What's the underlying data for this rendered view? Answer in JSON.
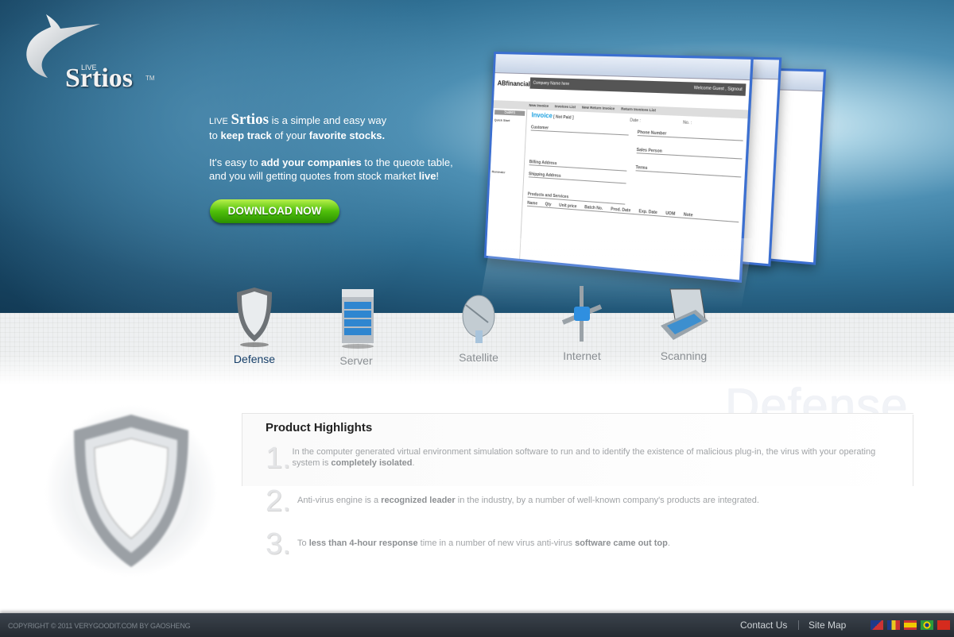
{
  "brand": {
    "name": "Srtios",
    "prefix": "LIVE",
    "tm": "TM"
  },
  "hero": {
    "line1_brand": "Srtios",
    "line1_prefix": "LIVE",
    "line1_rest": " is a simple and easy way",
    "line2_a": "to ",
    "line2_b": "keep track",
    "line2_c": " of your ",
    "line2_d": "favorite stocks.",
    "line3_a": "It's easy to ",
    "line3_b": "add your companies",
    "line3_c": " to the queote table,",
    "line4_a": "and you will getting quotes from stock market ",
    "line4_b": "live",
    "line4_c": "!",
    "download_label": "DOWNLOAD NOW"
  },
  "mockup": {
    "company": "Company Name here",
    "welcome": "Welcome Guest , Signout",
    "logo": "ABfinancial",
    "section": "Sales",
    "tabs": [
      "New Invoice",
      "Invoices List",
      "New Return Invoice",
      "Return Invoices List"
    ],
    "invoice": "Invoice",
    "status": "[ Not Paid ]",
    "date": "Date :",
    "no": "No. :",
    "groups": [
      "Customer",
      "Billing Address",
      "Shipping Address",
      "Phone Number",
      "Sales Person",
      "Terms"
    ],
    "products": "Products and Services",
    "columns": [
      "Name",
      "Qty",
      "Unit price",
      "Batch No.",
      "Prod. Date",
      "Exp. Date",
      "UOM",
      "Note"
    ],
    "quick_start": "Quick Start",
    "reminder": "Reminder"
  },
  "categories": [
    {
      "label": "Defense",
      "icon": "shield-icon",
      "active": true
    },
    {
      "label": "Server",
      "icon": "server-icon",
      "active": false
    },
    {
      "label": "Satellite",
      "icon": "satellite-dish-icon",
      "active": false
    },
    {
      "label": "Internet",
      "icon": "network-connector-icon",
      "active": false
    },
    {
      "label": "Scanning",
      "icon": "scanner-icon",
      "active": false
    }
  ],
  "section": {
    "watermark": "Defense",
    "title": "Product Highlights",
    "items": [
      {
        "num": "1.",
        "a": "In the computer generated virtual environment simulation software to run and to identify the existence of malicious plug-in, the virus with your operating system is ",
        "b": "completely isolated",
        "c": "."
      },
      {
        "num": "2.",
        "a": "Anti-virus engine is a ",
        "b": "recognized leader",
        "c": " in the industry, by a number of well-known company's products are integrated."
      },
      {
        "num": "3.",
        "a": "To ",
        "b": "less than 4-hour response",
        "c": " time in a number of new virus anti-virus ",
        "d": "software came out top",
        "e": "."
      }
    ]
  },
  "footer": {
    "copyright": "COPYRIGHT © 2011 VERYGOODIT.COM BY GAOSHENG",
    "contact": "Contact Us",
    "sitemap": "Site Map",
    "flags": [
      "australia-flag-icon",
      "romania-flag-icon",
      "spain-flag-icon",
      "brazil-flag-icon",
      "china-flag-icon"
    ]
  },
  "colors": {
    "accent_green": "#4fbf0a",
    "hero_blue": "#2f6f93",
    "active_category": "#17406a",
    "footer": "#2a3038"
  }
}
